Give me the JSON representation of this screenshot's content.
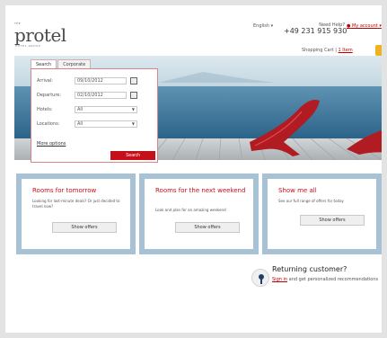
{
  "logo": {
    "the": "THE",
    "word": "protel",
    "group": "HOTEL GROUP"
  },
  "header": {
    "language": "English",
    "need_help": "Need Help?",
    "phone": "+49 231 915 930",
    "my_account": "My account",
    "cart_label": "Shopping Cart",
    "cart_count": "1 Item"
  },
  "search": {
    "tabs": [
      {
        "label": "Search",
        "active": true
      },
      {
        "label": "Corporate",
        "active": false
      }
    ],
    "arrival_label": "Arrival:",
    "arrival_value": "09/10/2012",
    "departure_label": "Departure:",
    "departure_value": "02/10/2012",
    "hotels_label": "Hotels:",
    "hotels_value": "All",
    "locations_label": "Locations:",
    "locations_value": "All",
    "more_options": "More options",
    "search_button": "Search"
  },
  "cards": [
    {
      "title": "Rooms for tomorrow",
      "text": "Looking for last-minute deals? Or just decided to travel now?",
      "button": "Show offers"
    },
    {
      "title": "Rooms for the next weekend",
      "text": "Look and plan for an amazing weekend",
      "button": "Show offers"
    },
    {
      "title": "Show me all",
      "text": "See our full range of offers for today",
      "button": "Show offers"
    }
  ],
  "returning": {
    "title": "Returning customer?",
    "sign_in": "Sign in",
    "rest": "and get personalized recommendations"
  },
  "colors": {
    "accent": "#c5101a",
    "card_border": "#a8c2d5",
    "cart_bag": "#f1b21f"
  }
}
